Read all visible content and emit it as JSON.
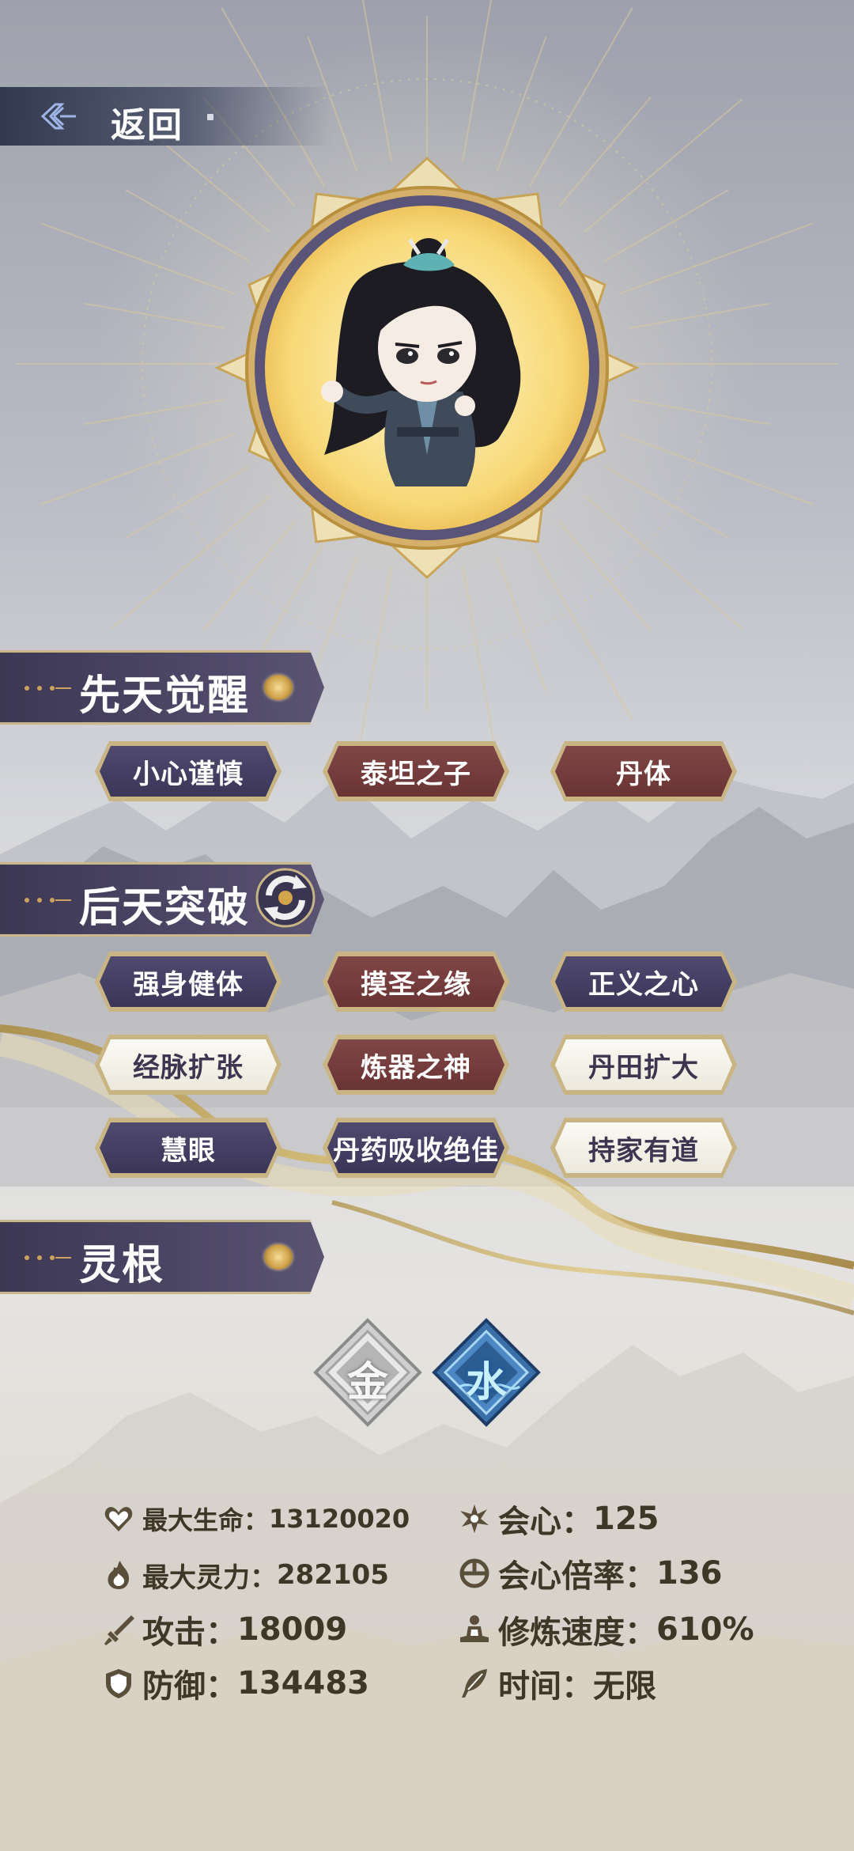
{
  "nav": {
    "back_label": "返回"
  },
  "sections": {
    "innate": {
      "title": "先天觉醒"
    },
    "acquired": {
      "title": "后天突破"
    },
    "spirit_root": {
      "title": "灵根"
    }
  },
  "innate_traits": [
    {
      "label": "小心谨慎",
      "style": "purple"
    },
    {
      "label": "泰坦之子",
      "style": "red"
    },
    {
      "label": "丹体",
      "style": "red"
    }
  ],
  "acquired_traits": [
    {
      "label": "强身健体",
      "style": "purple"
    },
    {
      "label": "摸圣之缘",
      "style": "red"
    },
    {
      "label": "正义之心",
      "style": "purple"
    },
    {
      "label": "经脉扩张",
      "style": "light"
    },
    {
      "label": "炼器之神",
      "style": "red"
    },
    {
      "label": "丹田扩大",
      "style": "light"
    },
    {
      "label": "慧眼",
      "style": "purple"
    },
    {
      "label": "丹药吸收绝佳",
      "style": "purple"
    },
    {
      "label": "持家有道",
      "style": "light"
    }
  ],
  "spirit_roots": [
    {
      "char": "金",
      "element": "metal"
    },
    {
      "char": "水",
      "element": "water"
    }
  ],
  "stats": {
    "max_hp": {
      "label": "最大生命：",
      "value": "13120020",
      "icon": "heart-icon"
    },
    "max_mana": {
      "label": "最大灵力：",
      "value": "282105",
      "icon": "flame-icon"
    },
    "attack": {
      "label": "攻击：",
      "value": "18009",
      "icon": "sword-icon"
    },
    "defense": {
      "label": "防御：",
      "value": "134483",
      "icon": "shield-icon"
    },
    "crit": {
      "label": "会心：",
      "value": "125",
      "icon": "burst-icon"
    },
    "crit_rate": {
      "label": "会心倍率：",
      "value": "136",
      "icon": "crosshair-icon"
    },
    "cultivation_speed": {
      "label": "修炼速度：",
      "value": "610%",
      "icon": "meditation-icon"
    },
    "time": {
      "label": "时间：",
      "value": "无限",
      "icon": "feather-icon"
    }
  },
  "colors": {
    "gold": "#c9b584",
    "purple_chip": "#3f3a5c",
    "red_chip": "#743a3a",
    "light_chip": "#f5f2e8",
    "stat_text": "#3e3626"
  }
}
